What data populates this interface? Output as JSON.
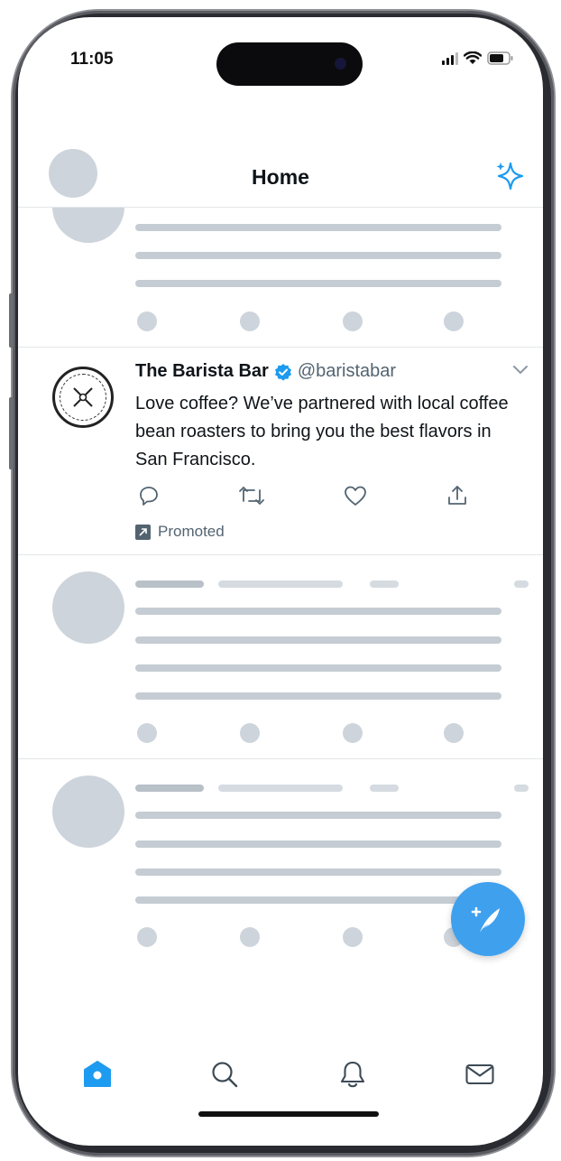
{
  "status_bar": {
    "time": "11:05"
  },
  "header": {
    "title": "Home"
  },
  "tweet": {
    "display_name": "The Barista Bar",
    "handle": "@baristabar",
    "text": "Love coffee? We’ve partnered with local coffee bean roasters to bring you the best flavors in San Francisco.",
    "promoted_label": "Promoted"
  },
  "tabbar": {
    "active": "home"
  },
  "colors": {
    "accent": "#1d9bf0",
    "fab": "#3fa0ee",
    "placeholder": "#cdd4db",
    "text": "#0f1419",
    "muted": "#536471"
  },
  "icons": [
    "sparkle-icon",
    "verified-badge-icon",
    "chevron-down-icon",
    "reply-icon",
    "retweet-icon",
    "like-icon",
    "share-icon",
    "promoted-icon",
    "compose-icon",
    "home-icon",
    "search-icon",
    "notifications-icon",
    "messages-icon"
  ]
}
